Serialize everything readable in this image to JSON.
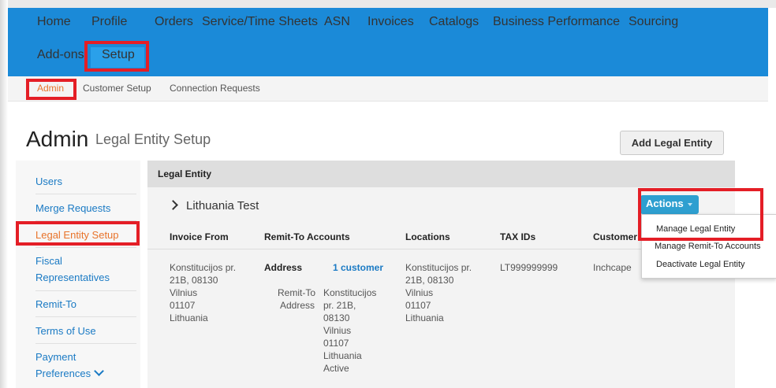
{
  "nav": {
    "items": [
      "Home",
      "Profile",
      "Orders",
      "Service/Time Sheets",
      "ASN",
      "Invoices",
      "Catalogs",
      "Business Performance",
      "Sourcing",
      "Add-ons",
      "Setup"
    ]
  },
  "subnav": {
    "items": [
      "Admin",
      "Customer Setup",
      "Connection Requests"
    ]
  },
  "page": {
    "title": "Admin",
    "subtitle": "Legal Entity Setup",
    "add_button": "Add Legal Entity"
  },
  "sidebar": {
    "items": [
      "Users",
      "Merge Requests",
      "Legal Entity Setup",
      "Fiscal",
      "Representatives",
      "Remit-To",
      "Terms of Use",
      "Payment",
      "Preferences"
    ]
  },
  "panel": {
    "header": "Legal Entity",
    "entity_name": "Lithuania Test",
    "columns": [
      "Invoice From",
      "Remit-To Accounts",
      "Locations",
      "TAX IDs",
      "Customer"
    ],
    "invoice_from": [
      "Konstitucijos pr.",
      "21B, 08130",
      "Vilnius",
      "01107",
      "Lithuania"
    ],
    "remit_address_label": "Address",
    "remit_customer_link": "1 customer",
    "remit_to_label": [
      "Remit-To",
      "Address"
    ],
    "remit_to_address": [
      "Konstitucijos",
      "pr. 21B,",
      "08130",
      "Vilnius",
      "01107",
      "Lithuania",
      "Active"
    ],
    "locations": [
      "Konstitucijos pr.",
      "21B, 08130",
      "Vilnius",
      "01107",
      "Lithuania"
    ],
    "tax_id": "LT999999999",
    "customer": "Inchcape"
  },
  "actions": {
    "button": "Actions",
    "menu": [
      "Manage Legal Entity",
      "Manage Remit-To Accounts",
      "Deactivate Legal Entity"
    ]
  },
  "colors": {
    "nav_bg": "#1b8ad8",
    "highlight": "#e41e26",
    "link": "#1a7ac4",
    "active_orange": "#e8732a",
    "actions_bg": "#2e9fd0"
  }
}
